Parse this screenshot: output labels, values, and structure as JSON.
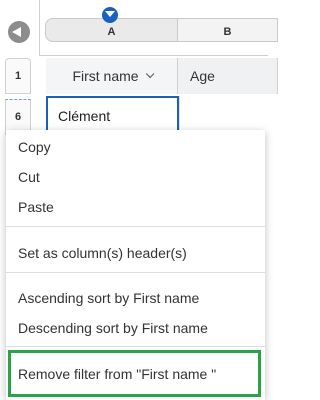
{
  "columns": {
    "a": "A",
    "b": "B"
  },
  "rows": {
    "r1": "1",
    "r6": "6"
  },
  "header": {
    "first_name": "First name",
    "age": "Age"
  },
  "cell": {
    "value": "Clément"
  },
  "menu": {
    "copy": "Copy",
    "cut": "Cut",
    "paste": "Paste",
    "set_header": "Set as column(s) header(s)",
    "sort_asc": "Ascending sort by First name",
    "sort_desc": "Descending sort by First name",
    "remove_filter": "Remove filter from \"First name \""
  },
  "colors": {
    "accent": "#1b5fbf",
    "highlight": "#2aa24a"
  }
}
